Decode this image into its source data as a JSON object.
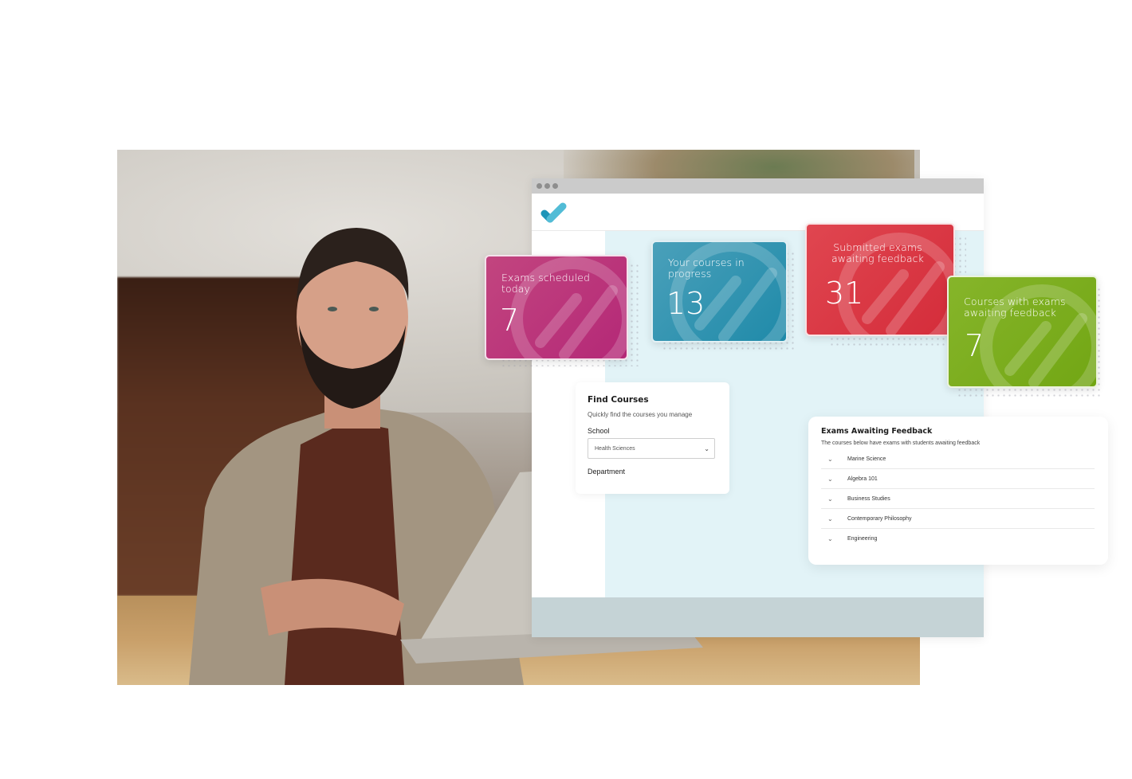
{
  "browser": {
    "window_controls": [
      "dot",
      "dot",
      "dot"
    ],
    "logo_icon": "checkmark-logo-icon"
  },
  "stat_cards": [
    {
      "id": "exams-scheduled",
      "label": "Exams scheduled today",
      "value": "7",
      "color": "#b8307a"
    },
    {
      "id": "courses-in-progress",
      "label": "Your courses in progress",
      "value": "13",
      "color": "#2990af"
    },
    {
      "id": "submitted-awaiting",
      "label": "Submitted exams awaiting feedback",
      "value": "31",
      "color": "#d9333f"
    },
    {
      "id": "courses-awaiting",
      "label": "Courses with exams awaiting feedback",
      "value": "7",
      "color": "#78aa1b"
    }
  ],
  "find_courses": {
    "title": "Find Courses",
    "subtitle": "Quickly find the courses you manage",
    "school_label": "School",
    "school_value": "Health Sciences",
    "department_label": "Department"
  },
  "exams_feedback": {
    "title": "Exams Awaiting Feedback",
    "subtitle": "The courses below have exams with students awaiting feedback",
    "courses": [
      "Marine Science",
      "Algebra 101",
      "Business Studies",
      "Contemporary Philosophy",
      "Engineering"
    ]
  }
}
